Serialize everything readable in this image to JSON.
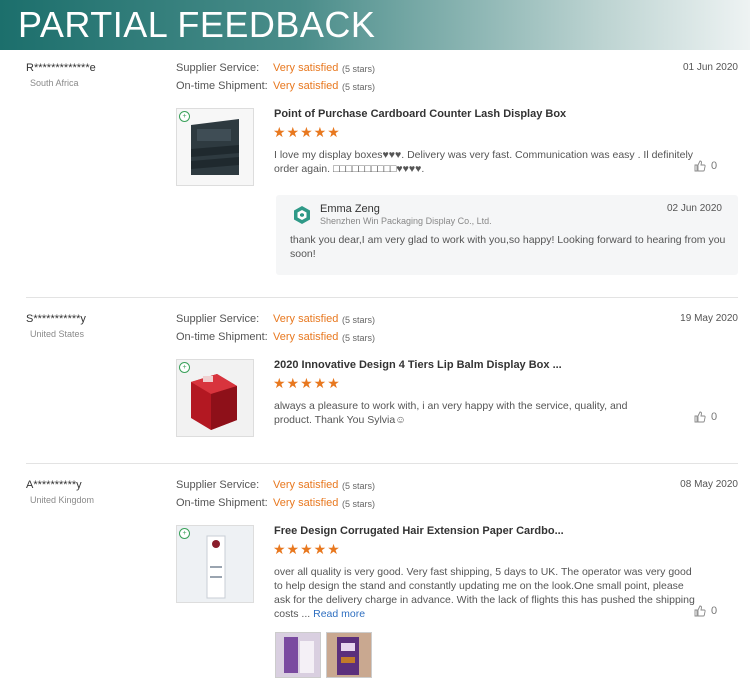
{
  "banner": {
    "title": "PARTIAL FEEDBACK"
  },
  "colors": {
    "accent": "#e8781f",
    "link": "#2f6fc0",
    "banner": "#1c6f6c"
  },
  "labels": {
    "supplier_service": "Supplier Service:",
    "ontime_shipment": "On-time Shipment:"
  },
  "reviews": [
    {
      "buyer": "R*************e",
      "country": "South Africa",
      "date": "01 Jun 2020",
      "supplier_rating": "Very satisfied",
      "supplier_stars": "(5 stars)",
      "shipment_rating": "Very satisfied",
      "shipment_stars": "(5 stars)",
      "product": "Point of Purchase Cardboard Counter Lash Display Box",
      "stars": "★★★★★",
      "comment": "I love my display boxes♥♥♥. Delivery was very fast. Communication was easy . Il definitely order again. □□□□□□□□□□♥♥♥♥.",
      "likes": "0",
      "reply": {
        "name": "Emma Zeng",
        "company": "Shenzhen Win Packaging Display Co., Ltd.",
        "date": "02 Jun 2020",
        "text": "thank you dear,I am very glad to work with you,so happy! Looking forward to hearing from you soon!"
      }
    },
    {
      "buyer": "S***********y",
      "country": "United States",
      "date": "19 May 2020",
      "supplier_rating": "Very satisfied",
      "supplier_stars": "(5 stars)",
      "shipment_rating": "Very satisfied",
      "shipment_stars": "(5 stars)",
      "product": "2020 Innovative Design 4 Tiers Lip Balm Display Box ...",
      "stars": "★★★★★",
      "comment": "always a pleasure to work with, i an very happy with the service, quality, and product. Thank You Sylvia☺",
      "likes": "0"
    },
    {
      "buyer": "A**********y",
      "country": "United Kingdom",
      "date": "08 May 2020",
      "supplier_rating": "Very satisfied",
      "supplier_stars": "(5 stars)",
      "shipment_rating": "Very satisfied",
      "shipment_stars": "(5 stars)",
      "product": "Free Design Corrugated Hair Extension Paper Cardbo...",
      "stars": "★★★★★",
      "comment": "over all quality is very good. Very fast shipping, 5 days to UK. The operator was very good to help design the stand and constantly updating me on the look.One small point, please ask for the delivery charge in advance. With the lack of flights this has pushed the shipping costs ...",
      "read_more": "Read more",
      "likes": "0"
    }
  ]
}
